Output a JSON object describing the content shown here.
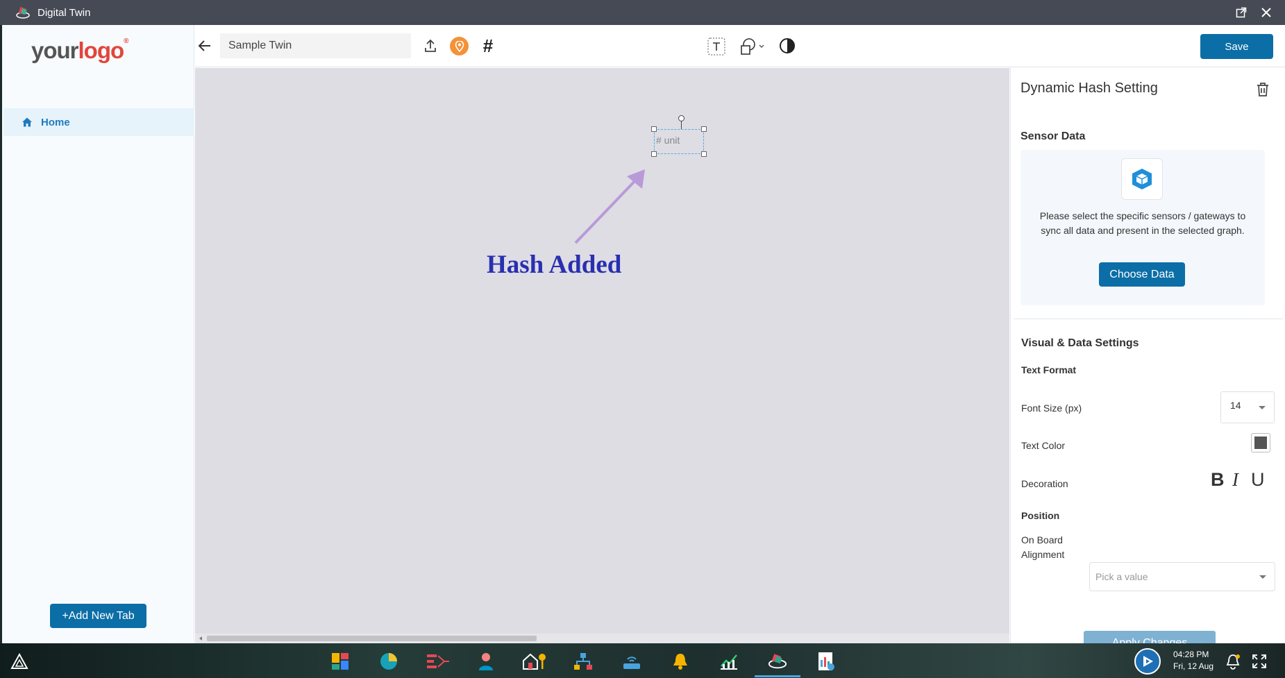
{
  "window": {
    "title": "Digital Twin"
  },
  "sidebar": {
    "logo_your": "your",
    "logo_logo": "logo",
    "logo_reg": "®",
    "nav": [
      {
        "label": "Home",
        "icon": "home-icon",
        "active": true
      }
    ],
    "add_tab_label": "+Add New Tab"
  },
  "toolbar": {
    "twin_name": "Sample Twin",
    "save_label": "Save",
    "hash_symbol": "#"
  },
  "canvas": {
    "widget_text": "# unit",
    "annotation": "Hash Added"
  },
  "panel": {
    "title": "Dynamic Hash Setting",
    "sensor_heading": "Sensor Data",
    "sensor_text": "Please select the specific sensors / gateways to sync all data and present in the selected graph.",
    "choose_data_label": "Choose Data",
    "visual_heading": "Visual & Data Settings",
    "text_format_heading": "Text Format",
    "font_size_label": "Font Size (px)",
    "font_size_value": "14",
    "text_color_label": "Text Color",
    "text_color_value": "#555555",
    "decoration_label": "Decoration",
    "bold_glyph": "B",
    "italic_glyph": "I",
    "underline_glyph": "U",
    "position_heading": "Position",
    "alignment_label_1": "On Board",
    "alignment_label_2": "Alignment",
    "alignment_placeholder": "Pick a value",
    "apply_label": "Apply Changes"
  },
  "taskbar": {
    "time": "04:28 PM",
    "date": "Fri, 12 Aug"
  },
  "colors": {
    "primary": "#0c6ea6",
    "canvas": "#dddde3",
    "annotation": "#2a2fb0",
    "arrow": "#b99ad8"
  }
}
